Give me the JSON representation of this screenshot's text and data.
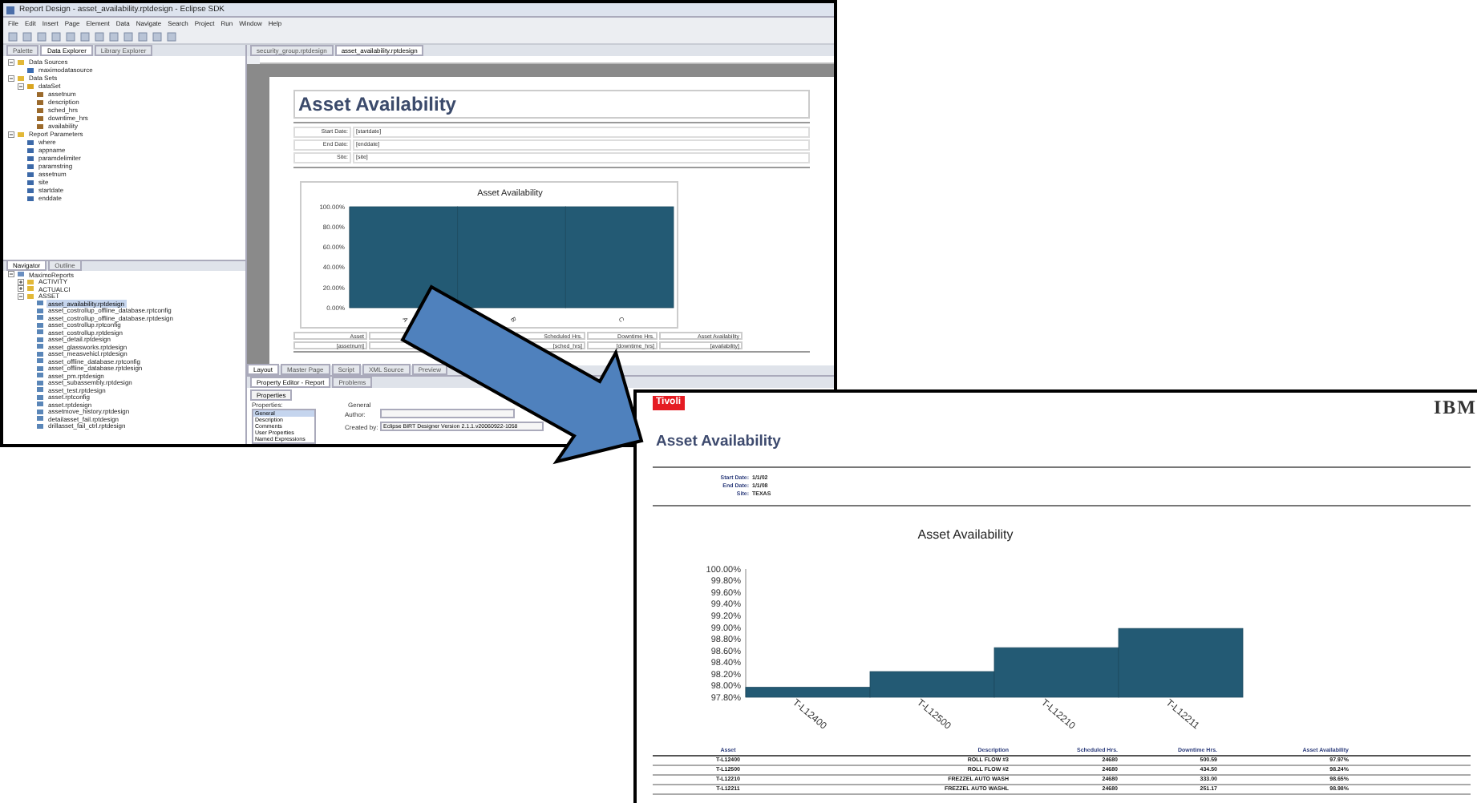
{
  "eclipse": {
    "title": "Report Design - asset_availability.rptdesign - Eclipse SDK",
    "menu": [
      "File",
      "Edit",
      "Insert",
      "Page",
      "Element",
      "Data",
      "Navigate",
      "Search",
      "Project",
      "Run",
      "Window",
      "Help"
    ],
    "left_tabs": [
      {
        "label": "Palette",
        "selected": false
      },
      {
        "label": "Data Explorer",
        "selected": true
      },
      {
        "label": "Library Explorer",
        "selected": false
      }
    ],
    "data_tree": [
      {
        "label": "Data Sources",
        "kind": "folder",
        "expanded": true,
        "children": [
          {
            "label": "maximodatasource",
            "kind": "datasource"
          }
        ]
      },
      {
        "label": "Data Sets",
        "kind": "folder",
        "expanded": true,
        "children": [
          {
            "label": "dataSet",
            "kind": "dataset",
            "expanded": true,
            "children": [
              {
                "label": "assetnum",
                "kind": "column"
              },
              {
                "label": "description",
                "kind": "column"
              },
              {
                "label": "sched_hrs",
                "kind": "column"
              },
              {
                "label": "downtime_hrs",
                "kind": "column"
              },
              {
                "label": "availability",
                "kind": "column"
              }
            ]
          }
        ]
      },
      {
        "label": "Report Parameters",
        "kind": "folder",
        "expanded": true,
        "children": [
          {
            "label": "where",
            "kind": "param"
          },
          {
            "label": "appname",
            "kind": "param"
          },
          {
            "label": "paramdelimiter",
            "kind": "param"
          },
          {
            "label": "paramstring",
            "kind": "param"
          },
          {
            "label": "assetnum",
            "kind": "param"
          },
          {
            "label": "site",
            "kind": "param"
          },
          {
            "label": "startdate",
            "kind": "param"
          },
          {
            "label": "enddate",
            "kind": "param"
          }
        ]
      }
    ],
    "navigator_tabs": [
      {
        "label": "Navigator",
        "selected": true
      },
      {
        "label": "Outline",
        "selected": false
      }
    ],
    "navigator_tree": [
      {
        "label": "MaximoReports",
        "kind": "project",
        "expanded": true,
        "children": [
          {
            "label": "ACTIVITY",
            "kind": "folder",
            "expanded": false
          },
          {
            "label": "ACTUALCI",
            "kind": "folder",
            "expanded": false
          },
          {
            "label": "ASSET",
            "kind": "folder",
            "expanded": true,
            "children": [
              {
                "label": "asset_availability.rptdesign",
                "kind": "file",
                "selected": true
              },
              {
                "label": "asset_costrollup_offline_database.rptconfig",
                "kind": "file",
                "selected": false
              },
              {
                "label": "asset_costrollup_offline_database.rptdesign",
                "kind": "file",
                "selected": false
              },
              {
                "label": "asset_costrollup.rptconfig",
                "kind": "file",
                "selected": false
              },
              {
                "label": "asset_costrollup.rptdesign",
                "kind": "file",
                "selected": false
              },
              {
                "label": "asset_detail.rptdesign",
                "kind": "file",
                "selected": false
              },
              {
                "label": "asset_glassworks.rptdesign",
                "kind": "file",
                "selected": false
              },
              {
                "label": "asset_measvehicl.rptdesign",
                "kind": "file",
                "selected": false
              },
              {
                "label": "asset_offline_database.rptconfig",
                "kind": "file",
                "selected": false
              },
              {
                "label": "asset_offline_database.rptdesign",
                "kind": "file",
                "selected": false
              },
              {
                "label": "asset_pm.rptdesign",
                "kind": "file",
                "selected": false
              },
              {
                "label": "asset_subassembly.rptdesign",
                "kind": "file",
                "selected": false
              },
              {
                "label": "asset_test.rptdesign",
                "kind": "file",
                "selected": false
              },
              {
                "label": "asset.rptconfig",
                "kind": "file",
                "selected": false
              },
              {
                "label": "asset.rptdesign",
                "kind": "file",
                "selected": false
              },
              {
                "label": "assetmove_history.rptdesign",
                "kind": "file",
                "selected": false
              },
              {
                "label": "detailasset_fail.rptdesign",
                "kind": "file",
                "selected": false
              },
              {
                "label": "drillasset_fail_ctrl.rptdesign",
                "kind": "file",
                "selected": false
              }
            ]
          }
        ]
      }
    ],
    "editor_tabs": [
      {
        "label": "security_group.rptdesign",
        "selected": false
      },
      {
        "label": "asset_availability.rptdesign",
        "selected": true
      }
    ],
    "design": {
      "title": "Asset Availability",
      "params": [
        {
          "label": "Start Date:",
          "value": "[startdate]"
        },
        {
          "label": "End Date:",
          "value": "[enddate]"
        },
        {
          "label": "Site:",
          "value": "[site]"
        }
      ],
      "chart": {
        "chart_data": {
          "type": "bar",
          "title": "Asset Availability",
          "categories": [
            "A",
            "B",
            "C"
          ],
          "values": [
            100,
            100,
            100
          ],
          "ylim": [
            0,
            100
          ],
          "yticks": [
            {
              "value": 0,
              "label": "0.00%"
            },
            {
              "value": 20,
              "label": "20.00%"
            },
            {
              "value": 40,
              "label": "40.00%"
            },
            {
              "value": 60,
              "label": "60.00%"
            },
            {
              "value": 80,
              "label": "80.00%"
            },
            {
              "value": 100,
              "label": "100.00%"
            }
          ]
        }
      },
      "columns": [
        {
          "kind": "shown",
          "header": "Asset",
          "field": "[assetnum]"
        },
        {
          "kind": "covered"
        },
        {
          "kind": "shown",
          "header": "Scheduled Hrs.",
          "field": "[sched_hrs]"
        },
        {
          "kind": "shown",
          "header": "Downtime Hrs.",
          "field": "[downtime_hrs]"
        },
        {
          "kind": "shown",
          "header": "Asset Availability",
          "field": "[availability]"
        }
      ]
    },
    "layout_tabs": [
      {
        "label": "Layout",
        "selected": true
      },
      {
        "label": "Master Page",
        "selected": false
      },
      {
        "label": "Script",
        "selected": false
      },
      {
        "label": "XML Source",
        "selected": false
      },
      {
        "label": "Preview",
        "selected": false
      }
    ],
    "property_editor": {
      "tabs": [
        {
          "label": "Property Editor - Report",
          "selected": true
        },
        {
          "label": "Problems",
          "selected": false
        }
      ],
      "subtab": "Properties",
      "properties_label": "Properties:",
      "section": "General",
      "categories": [
        {
          "label": "General",
          "selected": true
        },
        {
          "label": "Description",
          "selected": false
        },
        {
          "label": "Comments",
          "selected": false
        },
        {
          "label": "User Properties",
          "selected": false
        },
        {
          "label": "Named Expressions",
          "selected": false
        }
      ],
      "fields": [
        {
          "label": "Author:"
        },
        {
          "label": "Created by:",
          "value": "Eclipse BIRT Designer Version 2.1.1.v20060922-1058"
        }
      ]
    }
  },
  "report": {
    "brand": "Tivoli",
    "logo": "IBM",
    "title": "Asset Availability",
    "params": [
      {
        "label": "Start Date:",
        "value": "1/1/02"
      },
      {
        "label": "End Date:",
        "value": "1/1/08"
      },
      {
        "label": "Site:",
        "value": "TEXAS"
      }
    ],
    "chart": {
      "chart_data": {
        "type": "bar",
        "title": "Asset Availability",
        "categories": [
          "T-L12400",
          "T-L12500",
          "T-L12210",
          "T-L12211"
        ],
        "values": [
          97.97,
          98.24,
          98.65,
          98.98
        ],
        "ylim": [
          97.8,
          100
        ],
        "yticks": [
          {
            "value": 97.8,
            "label": "97.80%"
          },
          {
            "value": 98,
            "label": "98.00%"
          },
          {
            "value": 98.2,
            "label": "98.20%"
          },
          {
            "value": 98.4,
            "label": "98.40%"
          },
          {
            "value": 98.6,
            "label": "98.60%"
          },
          {
            "value": 98.8,
            "label": "98.80%"
          },
          {
            "value": 99,
            "label": "99.00%"
          },
          {
            "value": 99.2,
            "label": "99.20%"
          },
          {
            "value": 99.4,
            "label": "99.40%"
          },
          {
            "value": 99.6,
            "label": "99.60%"
          },
          {
            "value": 99.8,
            "label": "99.80%"
          },
          {
            "value": 100,
            "label": "100.00%"
          }
        ]
      }
    },
    "table": {
      "columns": [
        "Asset",
        "Description",
        "Scheduled Hrs.",
        "Downtime Hrs.",
        "Asset Availability"
      ],
      "rows": [
        [
          "T-L12400",
          "ROLL FLOW #3",
          "24680",
          "500.59",
          "97.97%"
        ],
        [
          "T-L12500",
          "ROLL FLOW #2",
          "24680",
          "434.50",
          "98.24%"
        ],
        [
          "T-L12210",
          "FREZZEL AUTO WASH",
          "24680",
          "333.00",
          "98.65%"
        ],
        [
          "T-L12211",
          "FREZZEL AUTO WASHL",
          "24680",
          "251.17",
          "98.98%"
        ]
      ]
    }
  }
}
